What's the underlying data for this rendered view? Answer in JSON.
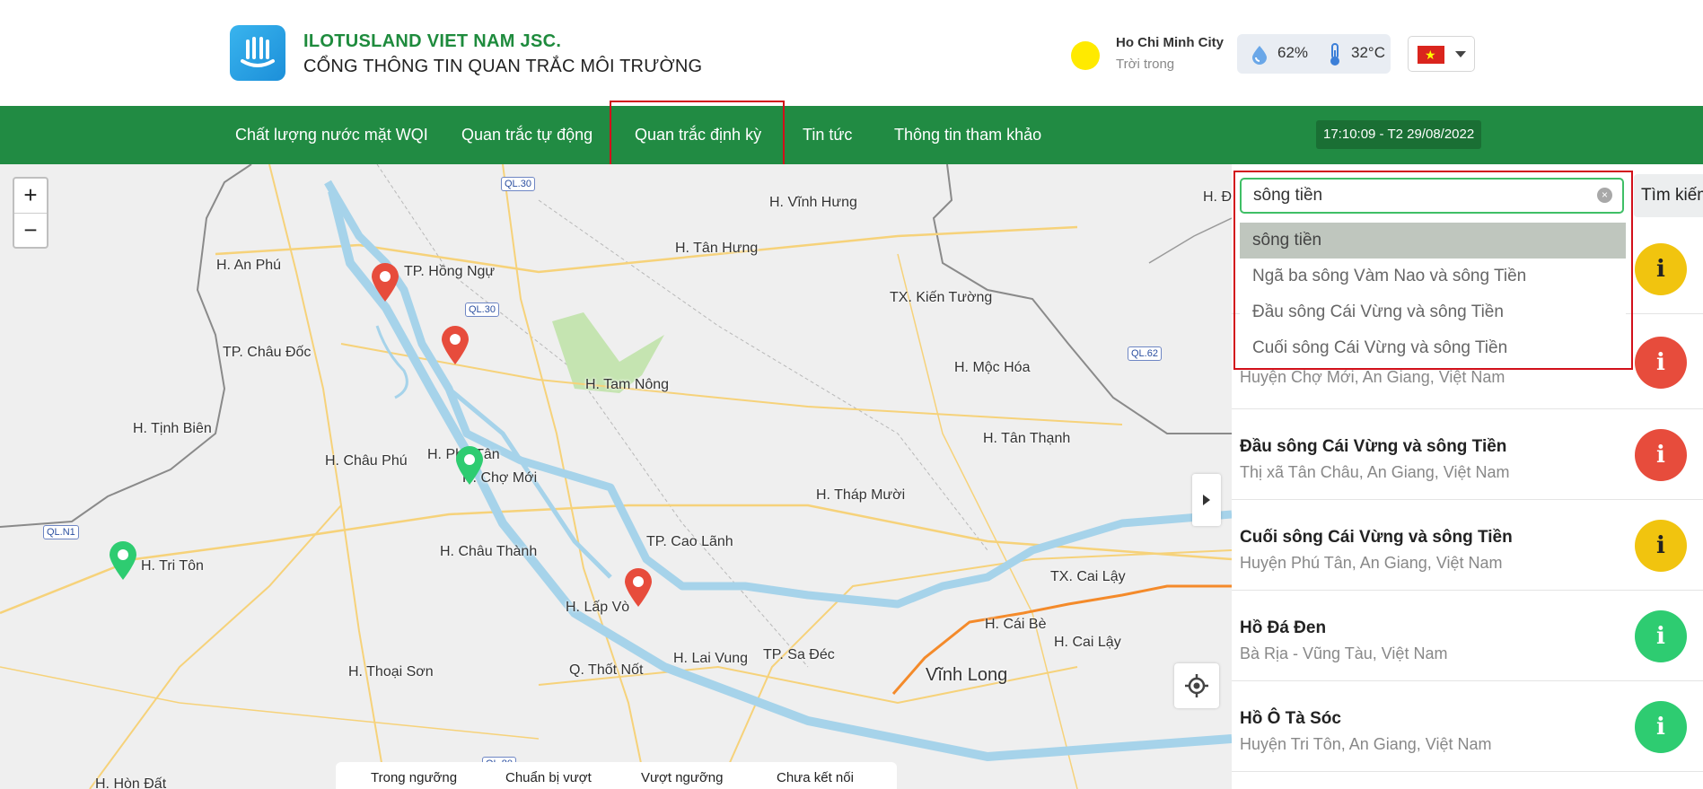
{
  "header": {
    "company": "ILOTUSLAND VIET NAM JSC.",
    "portal_title": "CỔNG THÔNG TIN QUAN TRẮC MÔI TRƯỜNG",
    "logo_icon": "lotus-logo-icon"
  },
  "weather": {
    "city": "Ho Chi Minh City",
    "description": "Trời trong",
    "humidity": "62%",
    "temperature": "32°C",
    "icons": [
      "sun-icon",
      "water-drop-icon",
      "thermometer-icon"
    ]
  },
  "language": {
    "selected_flag": "vietnam-flag-icon",
    "flag_star": "★"
  },
  "nav": {
    "items": [
      {
        "label": "Chất lượng nước mặt WQI",
        "active": false
      },
      {
        "label": "Quan trắc tự động",
        "active": false
      },
      {
        "label": "Quan trắc định kỳ",
        "active": true
      },
      {
        "label": "Tin tức",
        "active": false
      },
      {
        "label": "Thông tin tham khảo",
        "active": false
      }
    ],
    "clock": "17:10:09 - T2 29/08/2022"
  },
  "map": {
    "zoom_in": "+",
    "zoom_out": "−",
    "labels": [
      "H. Vĩnh Hưng",
      "H. Tân Hưng",
      "TX. Kiến Tường",
      "H. Mộc Hóa",
      "H. Tân Thạnh",
      "H. An Phú",
      "TP. Hồng Ngự",
      "TP. Châu Đốc",
      "H. Tam Nông",
      "H. Tịnh Biên",
      "H. Châu Phú",
      "H. Phú Tân",
      "H. Chợ Mới",
      "H. Tháp Mười",
      "H. Châu Thành",
      "TP. Cao Lãnh",
      "H. Tri Tôn",
      "H. Lấp Vò",
      "TX. Cai Lậy",
      "H. Cái Bè",
      "H. Cai Lậy",
      "H. Thoại Sơn",
      "Q. Thốt Nốt",
      "H. Lai Vung",
      "TP. Sa Đéc",
      "Vĩnh Long",
      "H. Hòn Đất",
      "H. Đ"
    ],
    "road_badges": [
      "QL.30",
      "QL.30",
      "QL.62",
      "QL.N1",
      "QL.80"
    ],
    "legend": [
      "Trong ngưỡng",
      "Chuẩn bị vượt",
      "Vượt ngưỡng",
      "Chưa kết nối"
    ],
    "colors": {
      "land": "#efefef",
      "water": "#a6d3ea",
      "nav_green": "#218b43",
      "marker_red": "#e74c3c",
      "marker_green": "#2ecc71"
    }
  },
  "search": {
    "value": "sông tiền",
    "clear_icon": "clear-icon",
    "button_label": "Tìm kiếm",
    "suggestions": [
      "sông tiền",
      "Ngã ba sông Vàm Nao và sông Tiền",
      "Đầu sông Cái Vừng và sông Tiền",
      "Cuối sông Cái Vừng và sông Tiền"
    ]
  },
  "stations": [
    {
      "name": "",
      "address": "",
      "status": "warning",
      "badge": "i"
    },
    {
      "name": "",
      "address": "Huyện Chợ Mới, An Giang, Việt Nam",
      "status": "exceeded",
      "badge": "i"
    },
    {
      "name": "Đầu sông Cái Vừng và sông Tiền",
      "address": "Thị xã Tân Châu, An Giang, Việt Nam",
      "status": "exceeded",
      "badge": "i"
    },
    {
      "name": "Cuối sông Cái Vừng và sông Tiền",
      "address": "Huyện Phú Tân, An Giang, Việt Nam",
      "status": "warning",
      "badge": "i"
    },
    {
      "name": "Hồ Đá Đen",
      "address": "Bà Rịa - Vũng Tàu, Việt Nam",
      "status": "normal",
      "badge": "i"
    },
    {
      "name": "Hồ Ô Tà Sóc",
      "address": "Huyện Tri Tôn, An Giang, Việt Nam",
      "status": "normal",
      "badge": "i"
    }
  ],
  "status_colors": {
    "warning": "#f1c40f",
    "exceeded": "#e74c3c",
    "normal": "#2ecc71"
  }
}
